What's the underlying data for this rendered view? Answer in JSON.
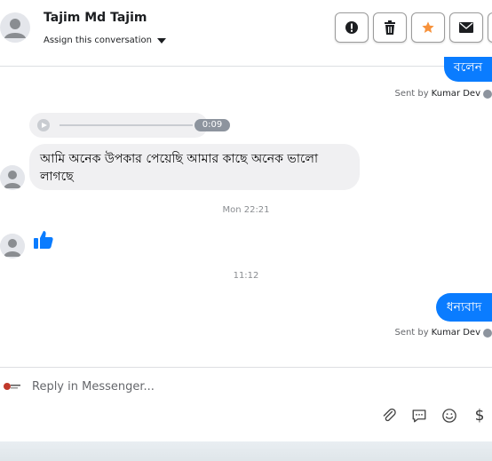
{
  "header": {
    "name": "Tajim Md Tajim",
    "assign_label": "Assign this conversation",
    "actions": [
      {
        "icon": "alert-icon"
      },
      {
        "icon": "trash-icon"
      },
      {
        "icon": "star-icon",
        "color": "#f7923b"
      },
      {
        "icon": "mail-icon"
      }
    ]
  },
  "messages": {
    "out_1": {
      "text": "বলেন",
      "sent_by_prefix": "Sent by",
      "sent_by_name": "Kumar Dev"
    },
    "audio": {
      "duration": "0:09"
    },
    "in_text": "আমি অনেক উপকার পেয়েছি আমার  কাছে অনেক ভালো লাগছে",
    "timestamp_1": "Mon 22:21",
    "like": {
      "icon": "thumbs-up-icon",
      "color": "#0a7cff"
    },
    "timestamp_2": "11:12",
    "out_2": {
      "text": "ধন্যবাদ",
      "sent_by_prefix": "Sent by",
      "sent_by_name": "Kumar Dev"
    }
  },
  "composer": {
    "placeholder": "Reply in Messenger...",
    "tools": [
      "paperclip-icon",
      "comment-icon",
      "emoji-icon",
      "dollar-icon"
    ],
    "dollar_glyph": "$"
  },
  "colors": {
    "accent": "#0a7cff",
    "star": "#f7923b"
  }
}
